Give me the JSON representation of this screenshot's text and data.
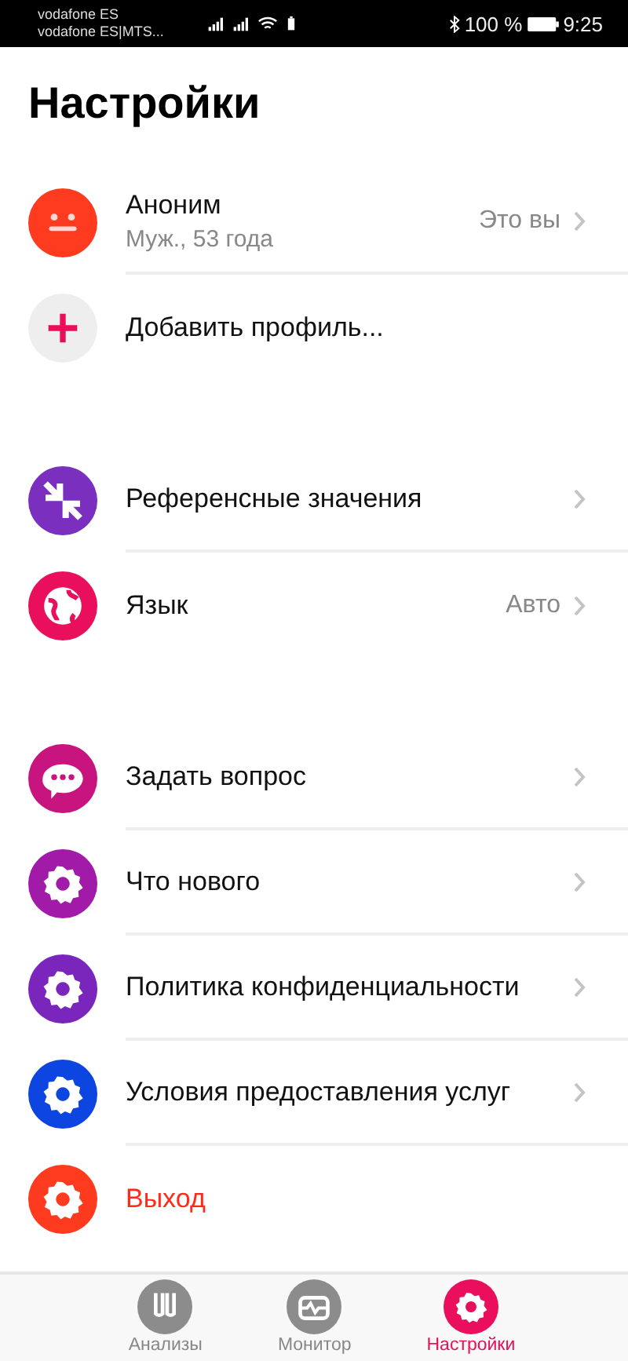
{
  "status_bar": {
    "carriers": [
      "vodafone ES",
      "vodafone ES|MTS..."
    ],
    "battery": "100 %",
    "time": "9:25"
  },
  "title": "Настройки",
  "sections": [
    {
      "items": [
        {
          "kind": "profile",
          "label": "Аноним",
          "sublabel": "Муж., 53 года",
          "value": "Это вы",
          "color": "#ff3b1f"
        },
        {
          "kind": "add",
          "label": "Добавить профиль...",
          "color": "#eeeeee"
        }
      ]
    },
    {
      "items": [
        {
          "kind": "arrows",
          "label": "Референсные значения",
          "color": "#7b2fbe"
        },
        {
          "kind": "globe",
          "label": "Язык",
          "value": "Авто",
          "color": "#ea0f5c"
        }
      ]
    },
    {
      "items": [
        {
          "kind": "chat",
          "label": "Задать вопрос",
          "color": "#c8147f"
        },
        {
          "kind": "gear",
          "label": "Что нового",
          "color": "#a21aa8"
        },
        {
          "kind": "gear",
          "label": "Политика конфиденциальности",
          "color": "#7a25bb"
        },
        {
          "kind": "gear",
          "label": "Условия предоставления услуг",
          "color": "#0c45e0"
        },
        {
          "kind": "exit",
          "label": "Выход",
          "color": "#ff3b1f"
        }
      ]
    }
  ],
  "tabs": [
    {
      "kind": "tubes",
      "label": "Анализы",
      "selected": false
    },
    {
      "kind": "monitor",
      "label": "Монитор",
      "selected": false
    },
    {
      "kind": "gear",
      "label": "Настройки",
      "selected": true
    }
  ]
}
